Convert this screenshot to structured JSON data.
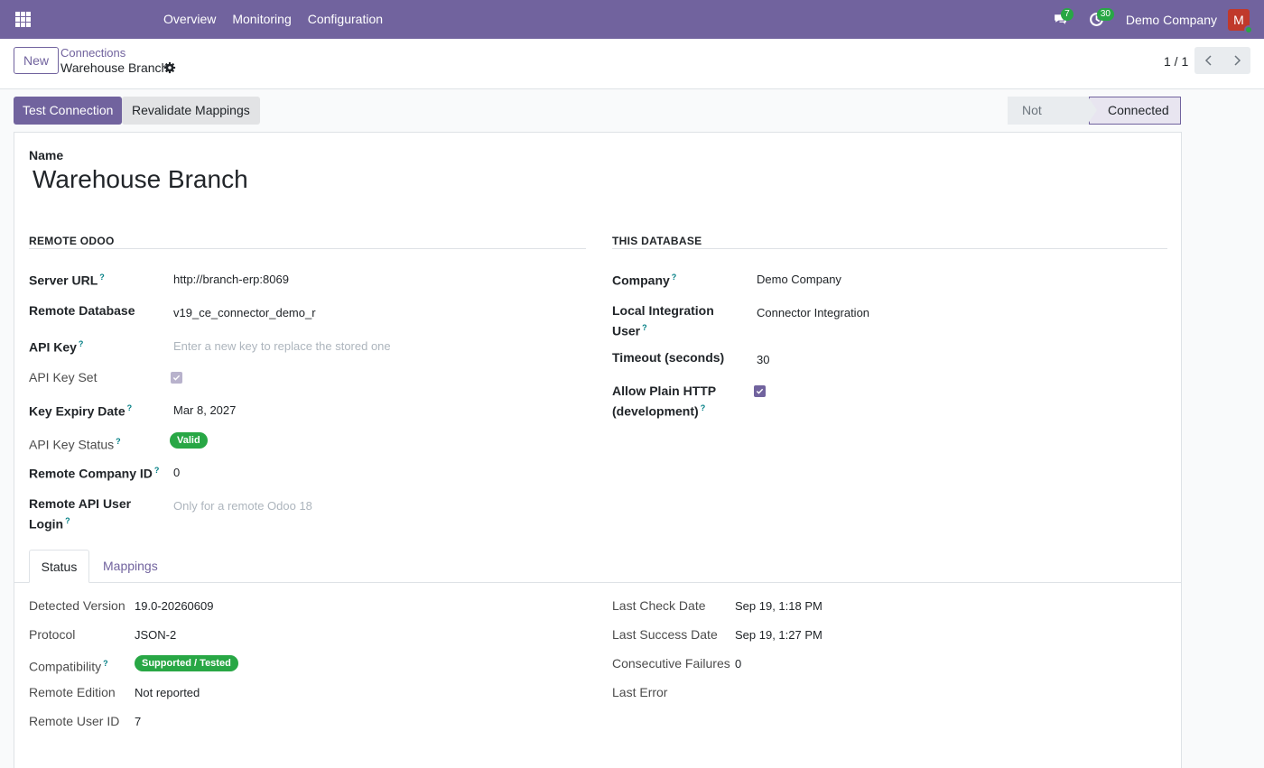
{
  "navbar": {
    "menu": [
      "Overview",
      "Monitoring",
      "Configuration"
    ],
    "messages_count": "7",
    "activities_count": "30",
    "company": "Demo Company",
    "avatar_letter": "M"
  },
  "control_panel": {
    "new_label": "New",
    "breadcrumb": "Connections",
    "record_title": "Warehouse Branch",
    "pager": "1 / 1"
  },
  "statusbar": {
    "test_connection": "Test Connection",
    "revalidate": "Revalidate Mappings",
    "stages": [
      "Not Tested",
      "Connected"
    ],
    "active_stage": "Connected"
  },
  "form": {
    "name_label": "Name",
    "name_value": "Warehouse Branch",
    "remote": {
      "title": "REMOTE ODOO",
      "server_url_label": "Server URL",
      "server_url": "http://branch-erp:8069",
      "remote_db_label": "Remote Database",
      "remote_db": "v19_ce_connector_demo_r",
      "api_key_label": "API Key",
      "api_key_placeholder": "Enter a new key to replace the stored one",
      "api_key_set_label": "API Key Set",
      "api_key_set": true,
      "expiry_label": "Key Expiry Date",
      "expiry": "Mar 8, 2027",
      "key_status_label": "API Key Status",
      "key_status": "Valid",
      "company_id_label": "Remote Company ID",
      "company_id": "0",
      "api_user_label_1": "Remote API User",
      "api_user_label_2": "Login",
      "api_user_placeholder": "Only for a remote Odoo 18"
    },
    "local": {
      "title": "THIS DATABASE",
      "company_label": "Company",
      "company": "Demo Company",
      "user_label_1": "Local Integration",
      "user_label_2": "User",
      "user": "Connector Integration",
      "timeout_label": "Timeout (seconds)",
      "timeout": "30",
      "http_label_1": "Allow Plain HTTP",
      "http_label_2": "(development)",
      "allow_http": true
    },
    "tabs": [
      "Status",
      "Mappings"
    ],
    "status": {
      "detected_version_label": "Detected Version",
      "detected_version": "19.0-20260609",
      "protocol_label": "Protocol",
      "protocol": "JSON-2",
      "compat_label": "Compatibility",
      "compat": "Supported / Tested",
      "edition_label": "Remote Edition",
      "edition": "Not reported",
      "user_id_label": "Remote User ID",
      "user_id": "7",
      "last_check_label": "Last Check Date",
      "last_check": "Sep 19, 1:18 PM",
      "last_success_label": "Last Success Date",
      "last_success": "Sep 19, 1:27 PM",
      "failures_label": "Consecutive Failures",
      "failures": "0",
      "last_error_label": "Last Error"
    }
  },
  "help_mark": "?",
  "colors": {
    "brand": "#71639e",
    "success": "#28a745",
    "help": "#017e84"
  }
}
